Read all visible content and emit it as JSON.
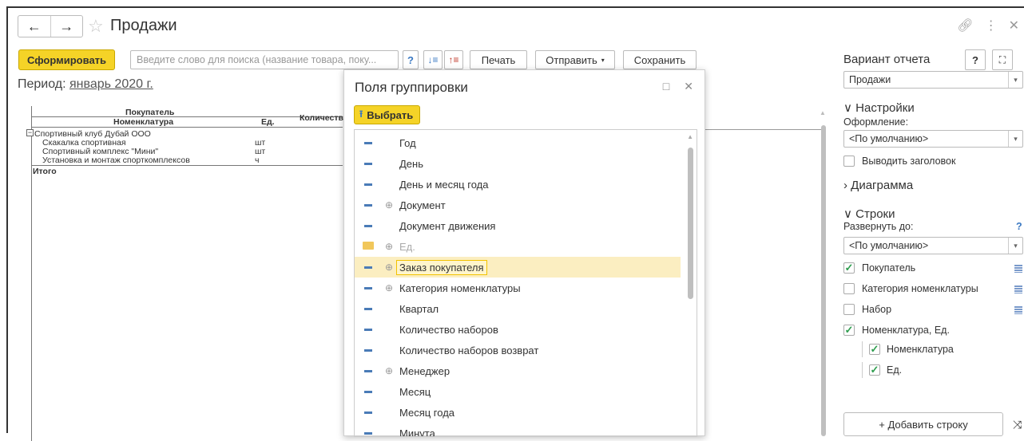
{
  "window": {
    "title": "Продажи",
    "back_icon": "←",
    "forward_icon": "→",
    "star_icon": "☆"
  },
  "toolbar": {
    "generate_label": "Сформировать",
    "search_placeholder": "Введите слово для поиска (название товара, поку...",
    "help_label": "?",
    "print_label": "Печать",
    "send_label": "Отправить",
    "save_label": "Сохранить",
    "right_help_label": "?"
  },
  "report": {
    "period_label": "Период:",
    "period_value": "январь 2020 г.",
    "header_buyer": "Покупатель",
    "header_nomenclature": "Номенклатура",
    "header_unit": "Ед.",
    "header_quantity": "Количеств",
    "rows": [
      {
        "name": "Спортивный клуб Дубай ООО",
        "unit": ""
      },
      {
        "name": "Скакалка спортивная",
        "unit": "шт"
      },
      {
        "name": "Спортивный комплекс \"Мини\"",
        "unit": "шт"
      },
      {
        "name": "Установка и монтаж спорткомплексов",
        "unit": "ч"
      }
    ],
    "total_label": "Итого"
  },
  "popup": {
    "title": "Поля группировки",
    "select_label": "Выбрать",
    "items": [
      {
        "label": "Год",
        "plus": false,
        "type": "field"
      },
      {
        "label": "День",
        "plus": false,
        "type": "field"
      },
      {
        "label": "День и месяц года",
        "plus": false,
        "type": "field"
      },
      {
        "label": "Документ",
        "plus": true,
        "type": "field"
      },
      {
        "label": "Документ движения",
        "plus": false,
        "type": "field"
      },
      {
        "label": "Ед.",
        "plus": true,
        "type": "folder"
      },
      {
        "label": "Заказ покупателя",
        "plus": true,
        "type": "field",
        "selected": true
      },
      {
        "label": "Категория номенклатуры",
        "plus": true,
        "type": "field"
      },
      {
        "label": "Квартал",
        "plus": false,
        "type": "field"
      },
      {
        "label": "Количество наборов",
        "plus": false,
        "type": "field"
      },
      {
        "label": "Количество наборов возврат",
        "plus": false,
        "type": "field"
      },
      {
        "label": "Менеджер",
        "plus": true,
        "type": "field"
      },
      {
        "label": "Месяц",
        "plus": false,
        "type": "field"
      },
      {
        "label": "Месяц года",
        "plus": false,
        "type": "field"
      },
      {
        "label": "Минута",
        "plus": false,
        "type": "field"
      }
    ]
  },
  "panel": {
    "variant_title": "Вариант отчета",
    "variant_value": "Продажи",
    "settings_title": "Настройки",
    "design_label": "Оформление:",
    "design_value": "<По умолчанию>",
    "show_title_label": "Выводить заголовок",
    "chart_title": "Диаграмма",
    "rows_title": "Строки",
    "expand_label": "Развернуть до:",
    "expand_help": "?",
    "expand_value": "<По умолчанию>",
    "groups": [
      {
        "label": "Покупатель",
        "checked": true
      },
      {
        "label": "Категория номенклатуры",
        "checked": false
      },
      {
        "label": "Набор",
        "checked": false
      },
      {
        "label": "Номенклатура, Ед.",
        "checked": true
      }
    ],
    "subgroups": [
      {
        "label": "Номенклатура",
        "checked": true
      },
      {
        "label": "Ед.",
        "checked": true
      }
    ],
    "add_row_label": "+ Добавить строку",
    "accent_color": "#2e9d4e"
  }
}
